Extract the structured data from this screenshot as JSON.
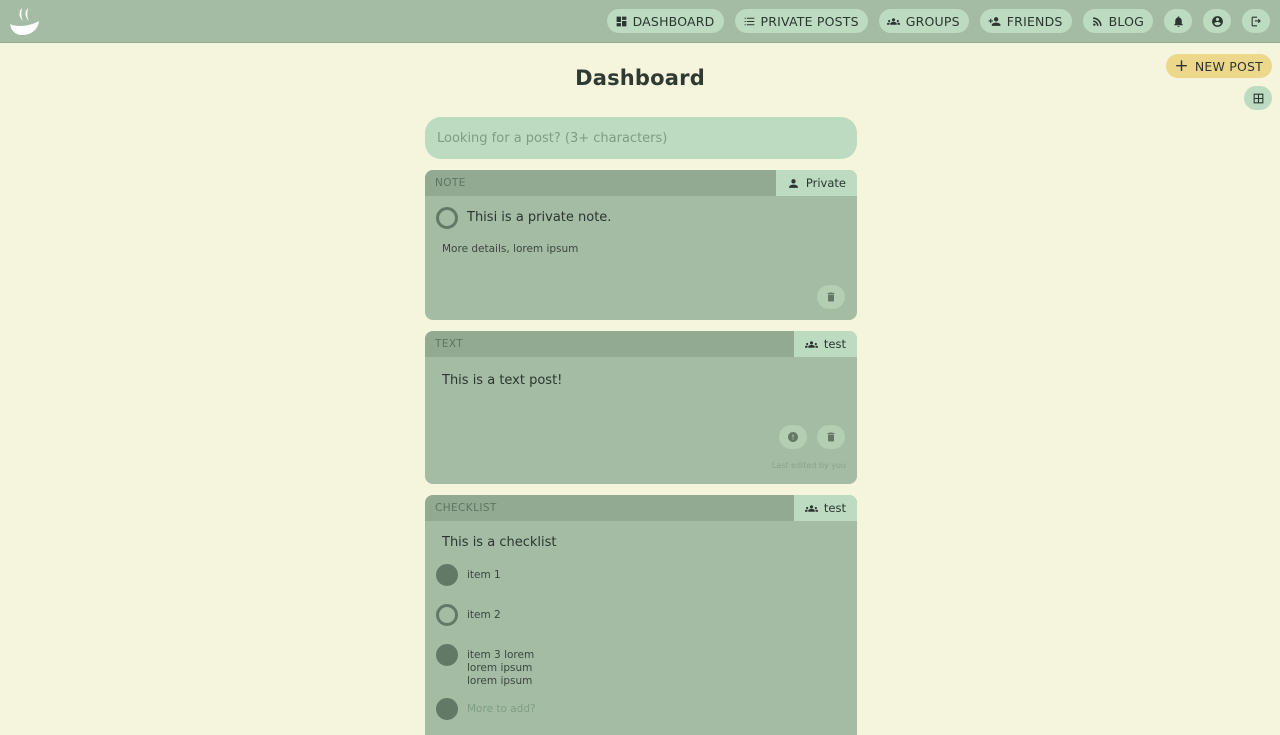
{
  "nav": {
    "items": [
      {
        "label": "DASHBOARD",
        "icon": "dashboard-icon"
      },
      {
        "label": "PRIVATE POSTS",
        "icon": "list-icon"
      },
      {
        "label": "GROUPS",
        "icon": "groups-icon"
      },
      {
        "label": "FRIENDS",
        "icon": "add-friend-icon"
      },
      {
        "label": "BLOG",
        "icon": "rss-icon"
      }
    ],
    "icon_buttons": [
      "bell-icon",
      "account-icon",
      "logout-icon"
    ]
  },
  "actions": {
    "new_post_label": "NEW POST"
  },
  "page": {
    "title": "Dashboard"
  },
  "search": {
    "placeholder": "Looking for a post? (3+ characters)"
  },
  "posts": [
    {
      "type": "NOTE",
      "tag": "Private",
      "title": "Thisi is a private note.",
      "details": "More details, lorem ipsum"
    },
    {
      "type": "TEXT",
      "tag": "test",
      "body": "This is a text post!",
      "edited": "Last edited by you"
    },
    {
      "type": "CHECKLIST",
      "tag": "test",
      "title": "This is a checklist",
      "items": [
        {
          "text": "item 1",
          "checked": true
        },
        {
          "text": "item 2",
          "checked": false
        },
        {
          "text": "item 3 lorem\nlorem ipsum\nlorem ipsum",
          "checked": true
        },
        {
          "text": "More to add?",
          "checked": true
        }
      ]
    }
  ],
  "colors": {
    "background": "#f5f4dc",
    "topbar": "#a3bca3",
    "pill": "#bddbc0",
    "new_post": "#edd78a",
    "card": "#a3bca3",
    "card_header": "#92a992"
  }
}
